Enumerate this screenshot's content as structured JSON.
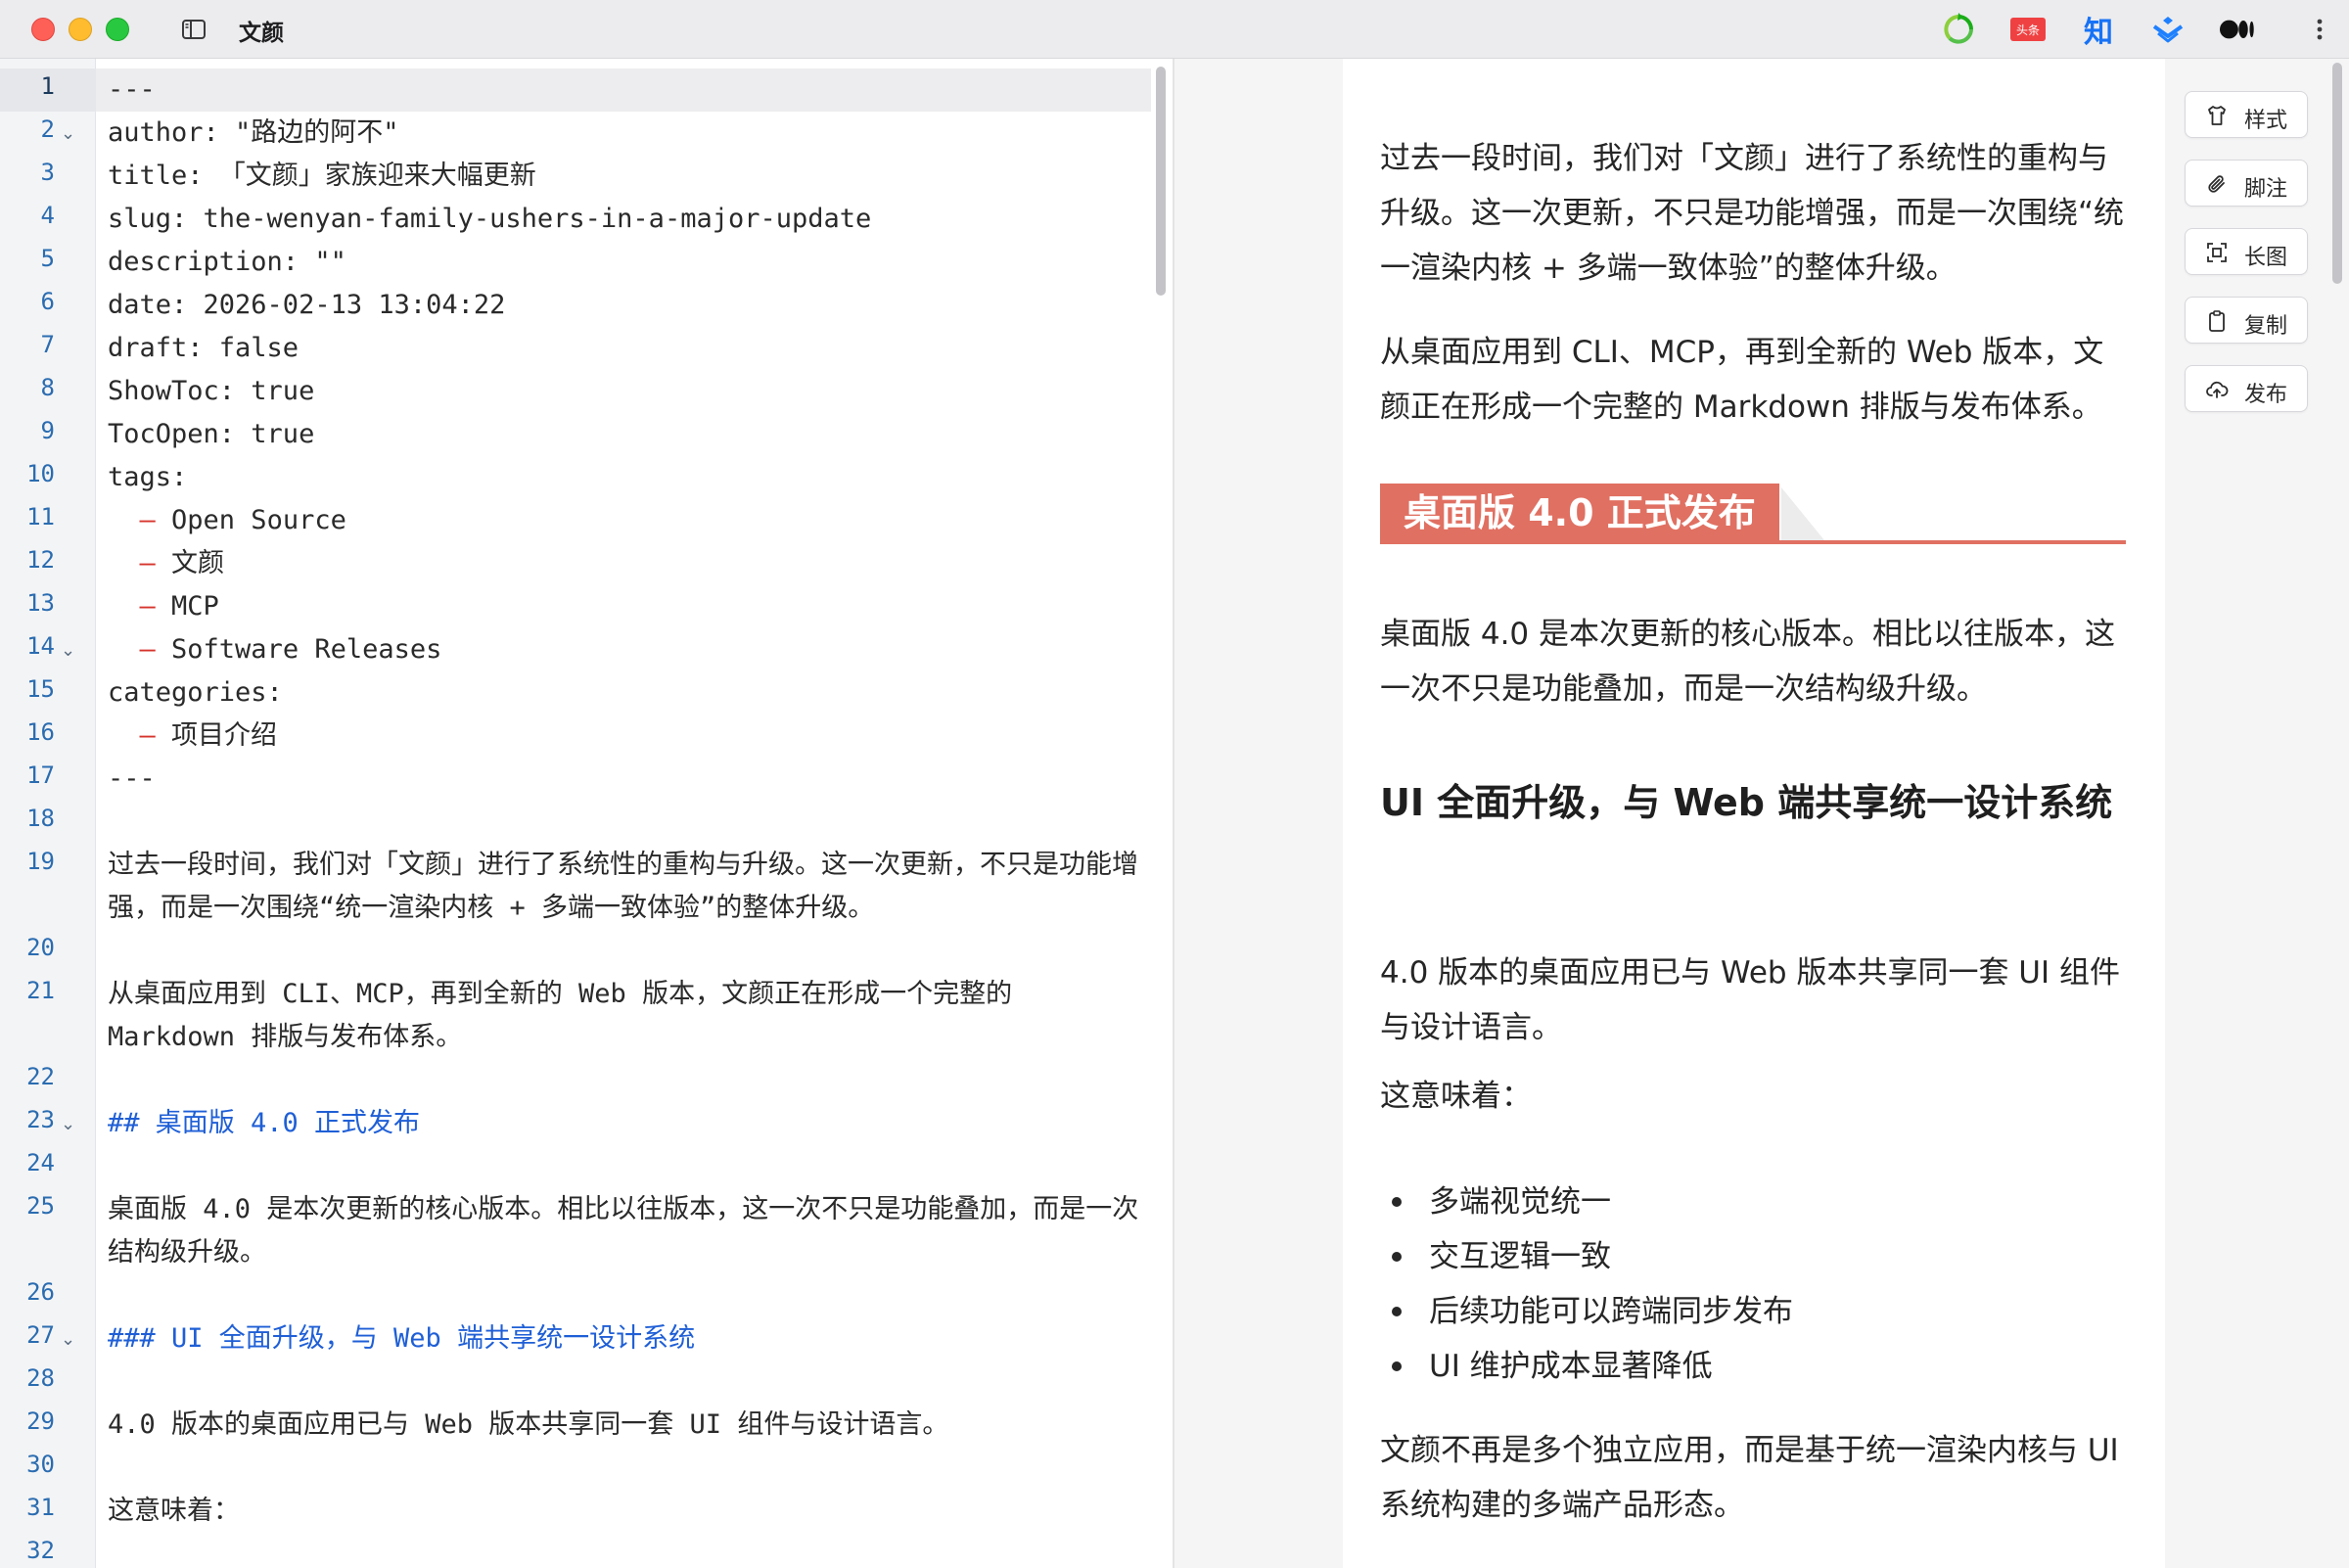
{
  "window": {
    "title": "文颜"
  },
  "toolbar": {
    "icons": [
      "wechat-sync-icon",
      "toutiao-icon",
      "zhihu-icon",
      "juejin-icon",
      "medium-icon",
      "more-icon"
    ],
    "toutiao_label": "头条",
    "zhihu_label": "知"
  },
  "editor": {
    "active_line": 1,
    "lines": [
      {
        "n": "1",
        "text": "---"
      },
      {
        "n": "2",
        "text": "author: \"路边的阿不\""
      },
      {
        "n": "3",
        "text": "title: 「文颜」家族迎来大幅更新"
      },
      {
        "n": "4",
        "text": "slug: the-wenyan-family-ushers-in-a-major-update"
      },
      {
        "n": "5",
        "text": "description: \"\""
      },
      {
        "n": "6",
        "text": "date: 2026-02-13 13:04:22"
      },
      {
        "n": "7",
        "text": "draft: false"
      },
      {
        "n": "8",
        "text": "ShowToc: true"
      },
      {
        "n": "9",
        "text": "TocOpen: true"
      },
      {
        "n": "10",
        "text": "tags:"
      },
      {
        "n": "11",
        "dash": "  – ",
        "text": "Open Source"
      },
      {
        "n": "12",
        "dash": "  – ",
        "text": "文颜"
      },
      {
        "n": "13",
        "dash": "  – ",
        "text": "MCP"
      },
      {
        "n": "14",
        "dash": "  – ",
        "text": "Software Releases"
      },
      {
        "n": "15",
        "text": "categories:"
      },
      {
        "n": "16",
        "dash": "  – ",
        "text": "项目介绍"
      },
      {
        "n": "17",
        "text": "---"
      },
      {
        "n": "18",
        "text": ""
      },
      {
        "n": "19",
        "text": "过去一段时间，我们对「文颜」进行了系统性的重构与升级。这一次更新，不只是功能增强，而是一次围绕“统一渲染内核 + 多端一致体验”的整体升级。"
      },
      {
        "n": "20",
        "text": ""
      },
      {
        "n": "21",
        "text": "从桌面应用到 CLI、MCP，再到全新的 Web 版本，文颜正在形成一个完整的 Markdown 排版与发布体系。"
      },
      {
        "n": "22",
        "text": ""
      },
      {
        "n": "23",
        "text": "## 桌面版 4.0 正式发布"
      },
      {
        "n": "24",
        "text": ""
      },
      {
        "n": "25",
        "text": "桌面版 4.0 是本次更新的核心版本。相比以往版本，这一次不只是功能叠加，而是一次结构级升级。"
      },
      {
        "n": "26",
        "text": ""
      },
      {
        "n": "27",
        "text": "### UI 全面升级，与 Web 端共享统一设计系统"
      },
      {
        "n": "28",
        "text": ""
      },
      {
        "n": "29",
        "text": "4.0 版本的桌面应用已与 Web 版本共享同一套 UI 组件与设计语言。"
      },
      {
        "n": "30",
        "text": ""
      },
      {
        "n": "31",
        "text": "这意味着："
      },
      {
        "n": "32",
        "text": ""
      }
    ]
  },
  "preview": {
    "intro": "过去一段时间，我们对「文颜」进行了系统性的重构与升级。这一次更新，不只是功能增强，而是一次围绕“统一渲染内核 + 多端一致体验”的整体升级。",
    "p2": "从桌面应用到 CLI、MCP，再到全新的 Web 版本，文颜正在形成一个完整的 Markdown 排版与发布体系。",
    "h2": "桌面版 4.0 正式发布",
    "p3": "桌面版 4.0 是本次更新的核心版本。相比以往版本，这一次不只是功能叠加，而是一次结构级升级。",
    "h3": "UI 全面升级，与 Web 端共享统一设计系统",
    "p4": "4.0 版本的桌面应用已与 Web 版本共享同一套 UI 组件与设计语言。",
    "p5": "这意味着：",
    "bullets": [
      "多端视觉统一",
      "交互逻辑一致",
      "后续功能可以跨端同步发布",
      "UI 维护成本显著降低"
    ],
    "p6": "文颜不再是多个独立应用，而是基于统一渲染内核与 UI 系统构建的多端产品形态。",
    "accent_color": "#e07062"
  },
  "actions": [
    {
      "label": "样式",
      "icon": "shirt-icon"
    },
    {
      "label": "脚注",
      "icon": "paperclip-icon"
    },
    {
      "label": "长图",
      "icon": "screenshot-icon"
    },
    {
      "label": "复制",
      "icon": "clipboard-icon"
    },
    {
      "label": "发布",
      "icon": "cloud-upload-icon"
    }
  ]
}
